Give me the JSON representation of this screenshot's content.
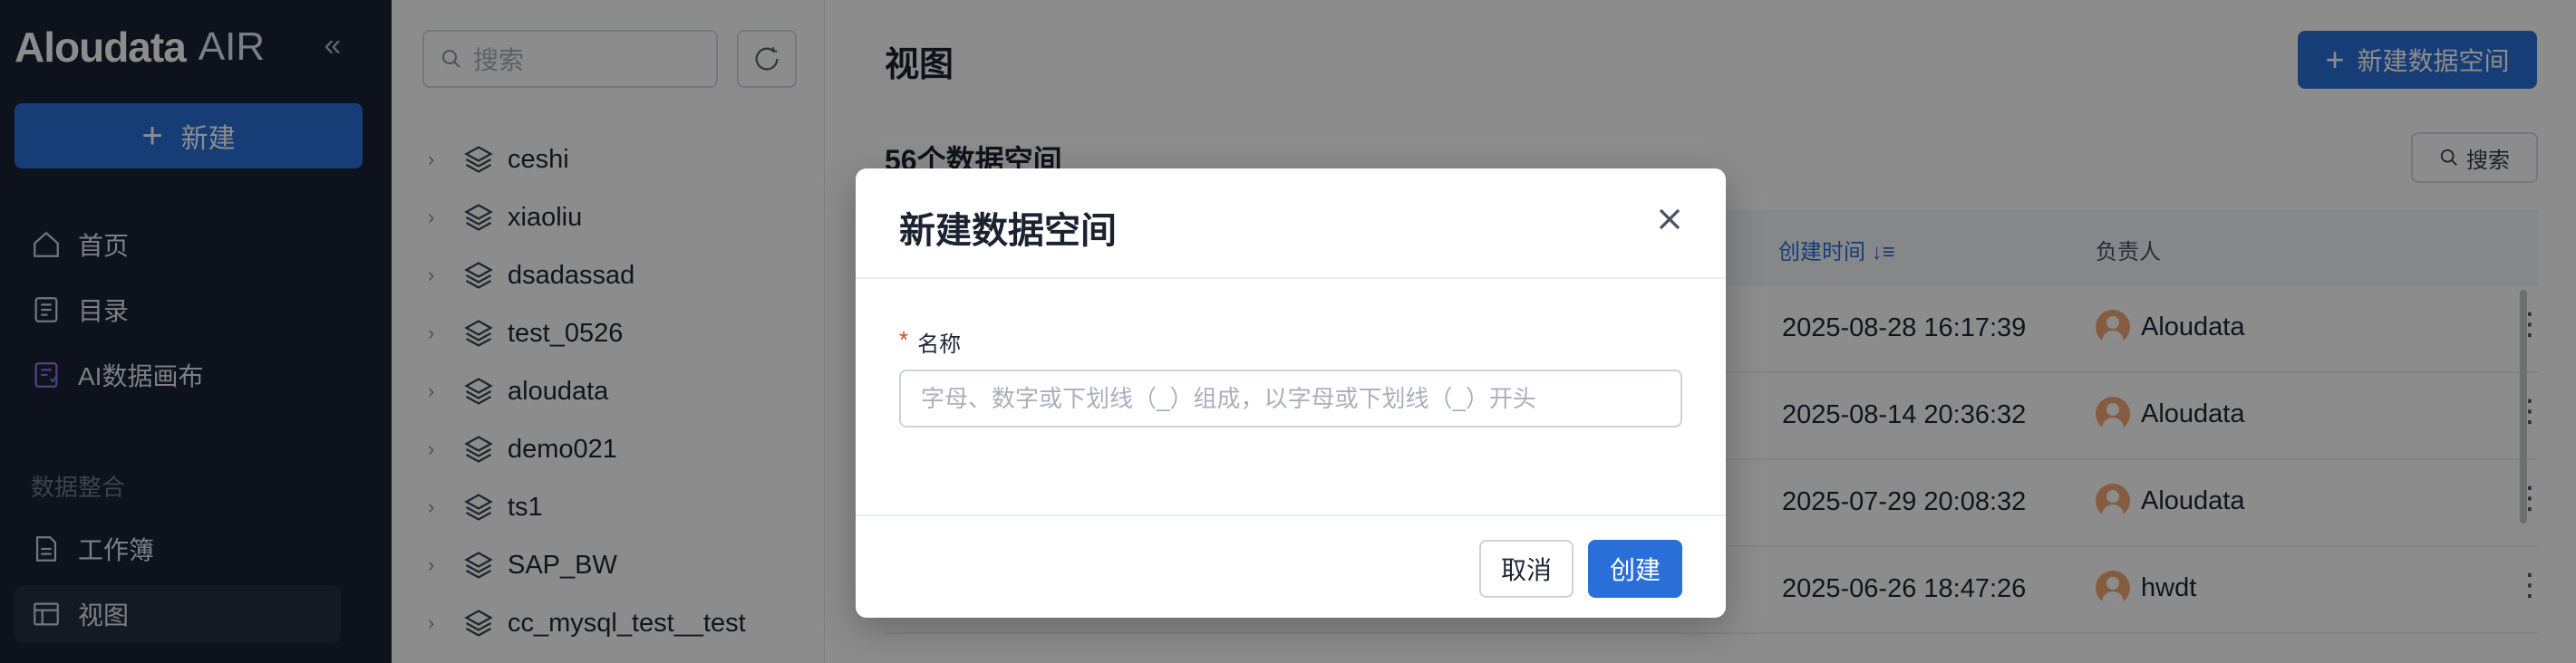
{
  "sidebar": {
    "brand": "Aloudata",
    "product": "AIR",
    "collapse_icon": "double-chevron-left-icon",
    "new_button": "新建",
    "nav": [
      {
        "label": "首页",
        "icon": "home-icon"
      },
      {
        "label": "目录",
        "icon": "catalog-icon"
      },
      {
        "label": "AI数据画布",
        "icon": "ai-canvas-icon"
      }
    ],
    "section_label": "数据整合",
    "section_nav": [
      {
        "label": "工作簿",
        "icon": "workbook-icon"
      },
      {
        "label": "视图",
        "icon": "view-icon",
        "active": true
      }
    ]
  },
  "tree": {
    "search_placeholder": "搜索",
    "items": [
      "ceshi",
      "xiaoliu",
      "dsadassad",
      "test_0526",
      "aloudata",
      "demo021",
      "ts1",
      "SAP_BW",
      "cc_mysql_test__test"
    ]
  },
  "main": {
    "title": "视图",
    "create_button": "新建数据空间",
    "count_text": "56个数据空间",
    "search_button": "搜索",
    "columns": {
      "created": "创建时间",
      "owner": "负责人"
    },
    "rows": [
      {
        "created": "2025-08-28 16:17:39",
        "owner": "Aloudata"
      },
      {
        "created": "2025-08-14 20:36:32",
        "owner": "Aloudata"
      },
      {
        "created": "2025-07-29 20:08:32",
        "owner": "Aloudata"
      },
      {
        "created": "2025-06-26 18:47:26",
        "owner": "hwdt"
      }
    ]
  },
  "modal": {
    "title": "新建数据空间",
    "field_label": "名称",
    "required_mark": "*",
    "input_placeholder": "字母、数字或下划线（_）组成，以字母或下划线（_）开头",
    "input_value": "",
    "cancel": "取消",
    "create": "创建"
  },
  "colors": {
    "accent": "#2a6fd8",
    "sidebar_bg": "#182233",
    "required": "#e0402f"
  }
}
